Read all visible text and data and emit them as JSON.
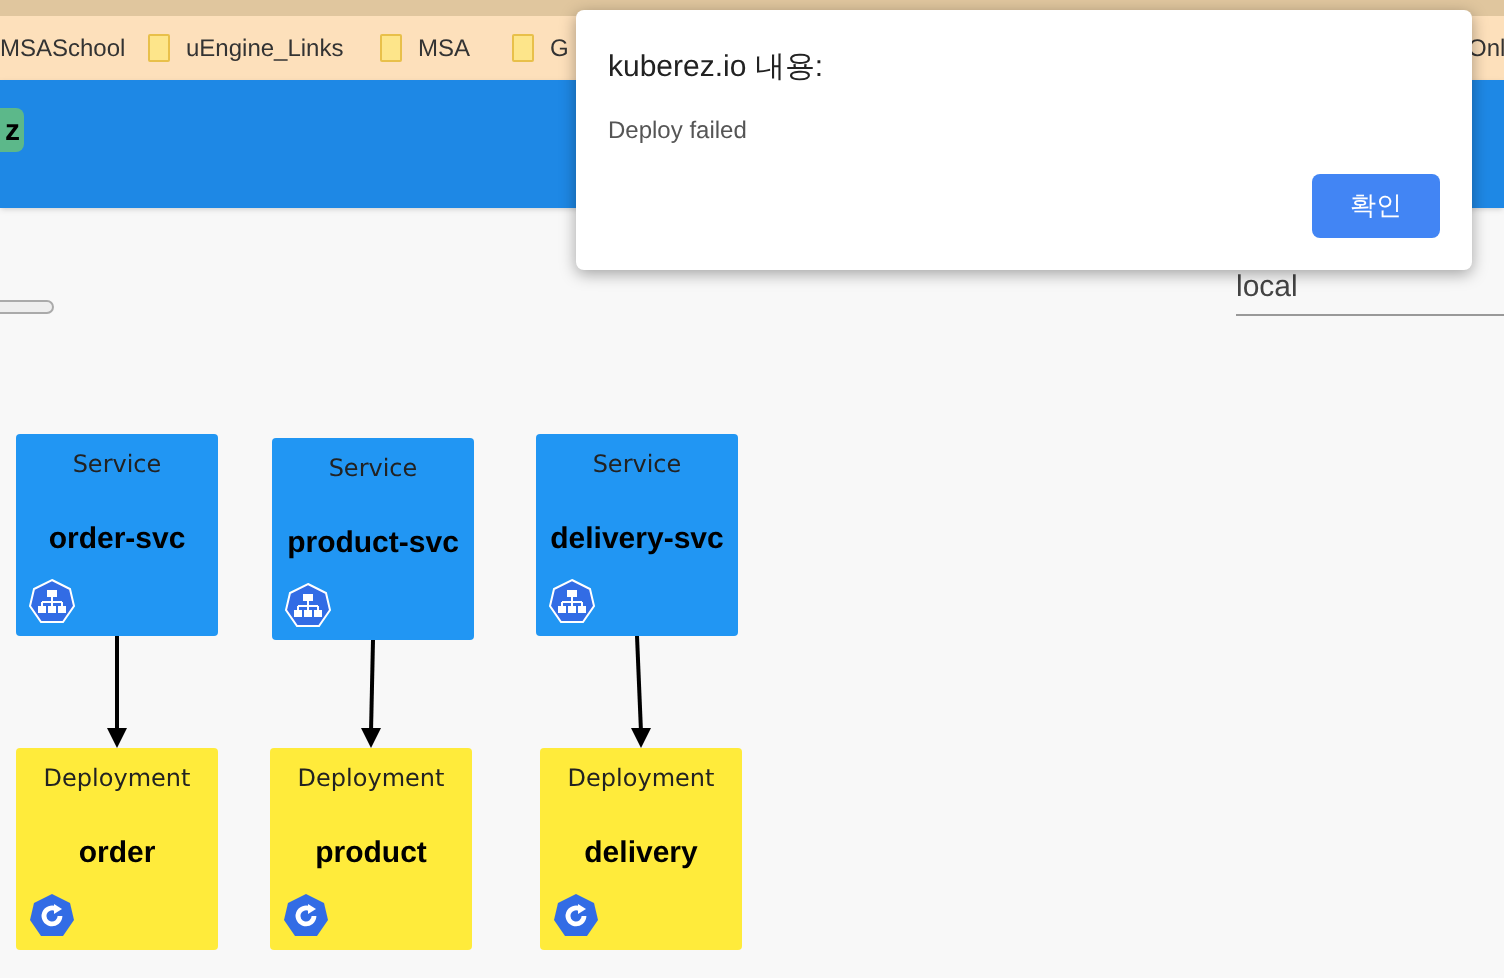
{
  "bookmarks": [
    {
      "label": "MSASchool",
      "folder": false
    },
    {
      "label": "uEngine_Links",
      "folder": true
    },
    {
      "label": "MSA",
      "folder": true
    },
    {
      "label": "G",
      "folder": true
    },
    {
      "label": "Onl",
      "folder": false
    }
  ],
  "app_bar": {
    "logo_text": "z"
  },
  "namespace_field": {
    "value": "local"
  },
  "diagram": {
    "nodes": [
      {
        "kind": "service",
        "type_label": "Service",
        "name": "order-svc"
      },
      {
        "kind": "service",
        "type_label": "Service",
        "name": "product-svc"
      },
      {
        "kind": "service",
        "type_label": "Service",
        "name": "delivery-svc"
      },
      {
        "kind": "deployment",
        "type_label": "Deployment",
        "name": "order"
      },
      {
        "kind": "deployment",
        "type_label": "Deployment",
        "name": "product"
      },
      {
        "kind": "deployment",
        "type_label": "Deployment",
        "name": "delivery"
      }
    ]
  },
  "dialog": {
    "title": "kuberez.io 내용:",
    "message": "Deploy failed",
    "button": "확인"
  }
}
